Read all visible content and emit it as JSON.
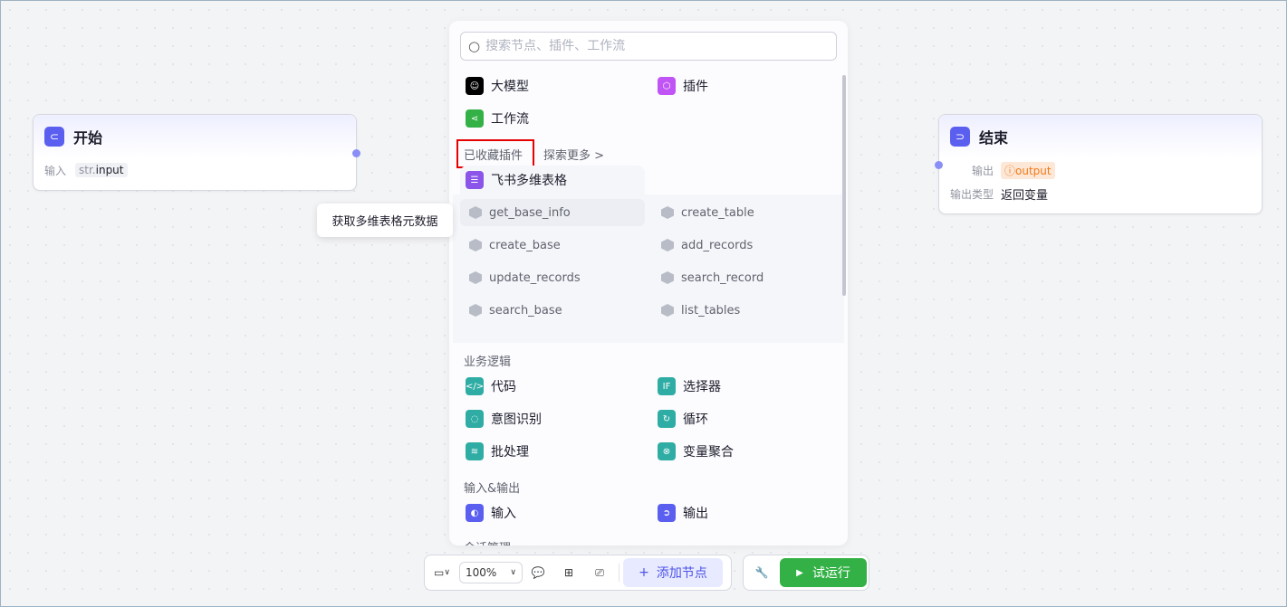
{
  "start_node": {
    "title": "开始",
    "input_label": "输入",
    "input_type": "str.",
    "input_name": "input"
  },
  "end_node": {
    "title": "结束",
    "output_label": "输出",
    "output_value": "output",
    "output_type_label": "输出类型",
    "output_type_value": "返回变量"
  },
  "panel": {
    "search_placeholder": "搜索节点、插件、工作流",
    "top_items": [
      {
        "label": "大模型",
        "icon": "llm-icon",
        "color": "#000000"
      },
      {
        "label": "插件",
        "icon": "plugin-icon",
        "color": "#c154f5"
      },
      {
        "label": "工作流",
        "icon": "workflow-icon",
        "color": "#33b146"
      }
    ],
    "favorites_tab": "已收藏插件",
    "explore_tab": "探索更多 >",
    "plugin_group": {
      "name": "飞书多维表格",
      "tools": [
        "get_base_info",
        "create_table",
        "create_base",
        "add_records",
        "update_records",
        "search_record",
        "search_base",
        "list_tables"
      ]
    },
    "tooltip": "获取多维表格元数据",
    "sections": [
      {
        "title": "业务逻辑",
        "items": [
          {
            "label": "代码",
            "glyph": "</>"
          },
          {
            "label": "选择器",
            "glyph": "IF"
          },
          {
            "label": "意图识别",
            "glyph": "◌"
          },
          {
            "label": "循环",
            "glyph": "↻"
          },
          {
            "label": "批处理",
            "glyph": "≋"
          },
          {
            "label": "变量聚合",
            "glyph": "⊗"
          }
        ]
      },
      {
        "title": "输入&输出",
        "items": [
          {
            "label": "输入",
            "glyph": "◐"
          },
          {
            "label": "输出",
            "glyph": "➲"
          }
        ]
      },
      {
        "title": "会话管理"
      }
    ],
    "teal": "#2fada4",
    "blue": "#5b5ff0"
  },
  "toolbar": {
    "zoom": "100%",
    "add_node": "添加节点",
    "run": "试运行",
    "run_color": "#33b146",
    "highlight_color": "#e60000"
  }
}
